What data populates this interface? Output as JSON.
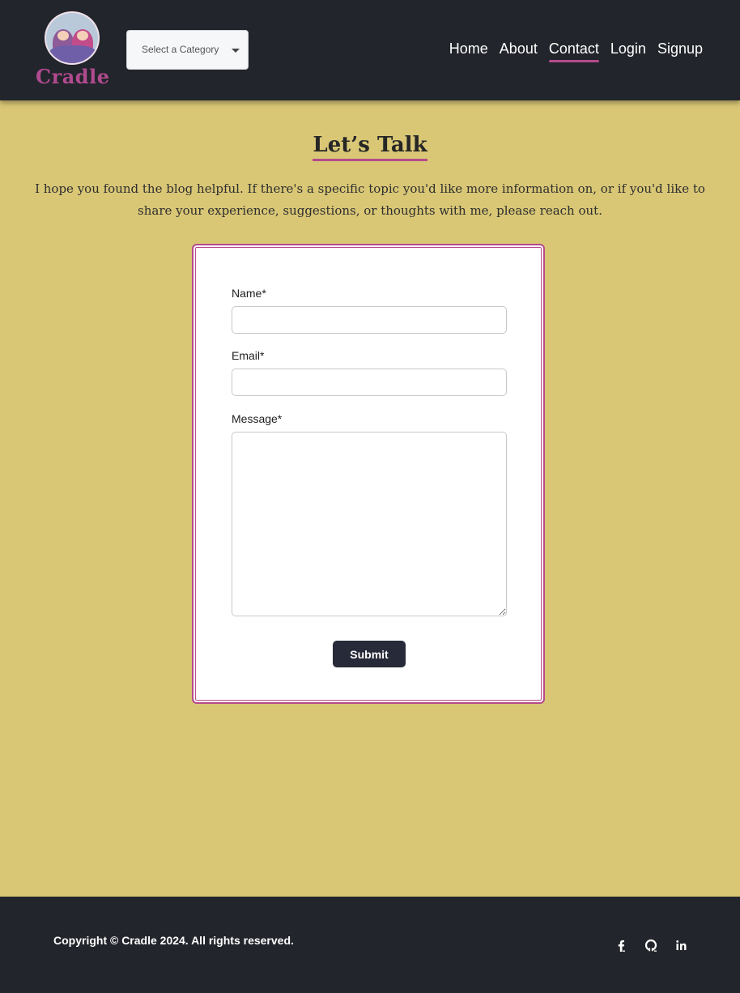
{
  "header": {
    "logo_text": "Cradle",
    "category_select": {
      "placeholder": "Select a Category"
    },
    "nav": [
      {
        "label": "Home",
        "active": false
      },
      {
        "label": "About",
        "active": false
      },
      {
        "label": "Contact",
        "active": true
      },
      {
        "label": "Login",
        "active": false
      },
      {
        "label": "Signup",
        "active": false
      }
    ]
  },
  "main": {
    "title": "Let’s Talk",
    "intro": "I hope you found the blog helpful. If there's a specific topic you'd like more information on, or if you'd like to share your experience, suggestions, or thoughts with me, please reach out.",
    "form": {
      "name_label": "Name*",
      "name_value": "",
      "email_label": "Email*",
      "email_value": "",
      "message_label": "Message*",
      "message_value": "",
      "submit_label": "Submit"
    }
  },
  "footer": {
    "copyright": "Copyright © Cradle 2024. All rights reserved.",
    "social": [
      {
        "icon": "facebook-icon"
      },
      {
        "icon": "github-icon"
      },
      {
        "icon": "linkedin-icon"
      }
    ]
  },
  "colors": {
    "page_background": "#d9c776",
    "nav_background": "#22252b",
    "accent": "#b54a8c",
    "button": "#272a38"
  }
}
